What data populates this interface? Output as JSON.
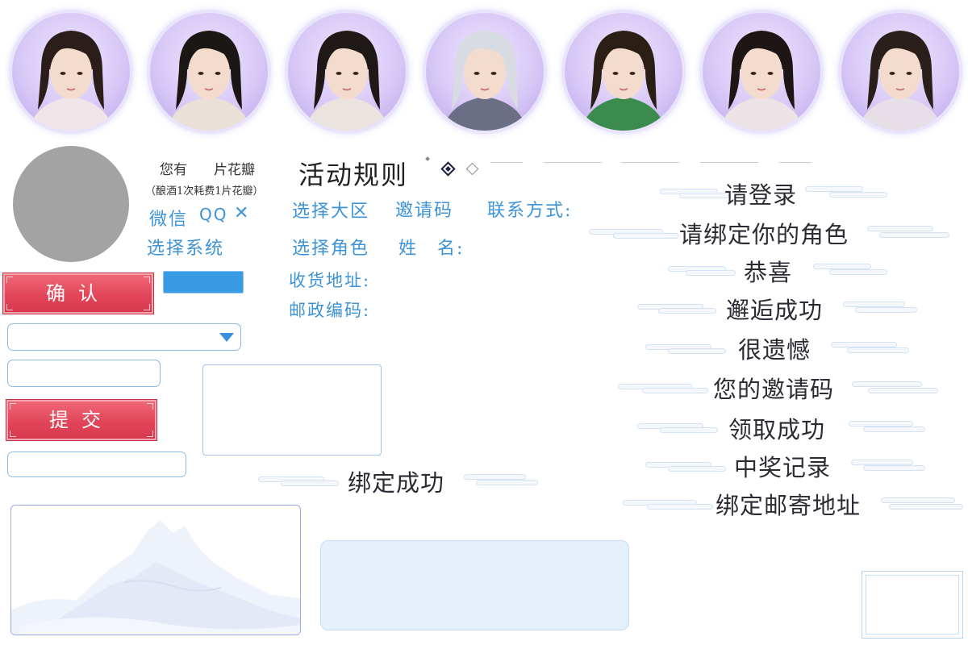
{
  "avatars": [
    {
      "name": "avatar-1"
    },
    {
      "name": "avatar-2"
    },
    {
      "name": "avatar-3"
    },
    {
      "name": "avatar-4"
    },
    {
      "name": "avatar-5"
    },
    {
      "name": "avatar-6"
    },
    {
      "name": "avatar-7"
    }
  ],
  "petals": {
    "you_have": "您有",
    "petals_unit": "片花瓣",
    "note": "（酿酒1次耗费1片花瓣）"
  },
  "login_options": {
    "wechat": "微信",
    "qq": "QQ",
    "close": "✕",
    "select_system": "选择系统"
  },
  "buttons": {
    "confirm": "确认",
    "submit": "提交"
  },
  "rules": {
    "title": "活动规则"
  },
  "form_labels": {
    "select_region": "选择大区",
    "invite_code": "邀请码",
    "contact": "联系方式:",
    "select_role": "选择角色",
    "name": "姓　名:",
    "address": "收货地址:",
    "postcode": "邮政编码:"
  },
  "popup_titles": {
    "please_login": "请登录",
    "bind_role": "请绑定你的角色",
    "congrats": "恭喜",
    "meet_success": "邂逅成功",
    "regret": "很遗憾",
    "your_invite_code": "您的邀请码",
    "claim_success": "领取成功",
    "win_record": "中奖记录",
    "bind_address": "绑定邮寄地址",
    "bind_success": "绑定成功"
  },
  "colors": {
    "accent_blue": "#3d93d8",
    "button_red": "#e2455a",
    "avatar_purple": "#d8c8f6"
  }
}
